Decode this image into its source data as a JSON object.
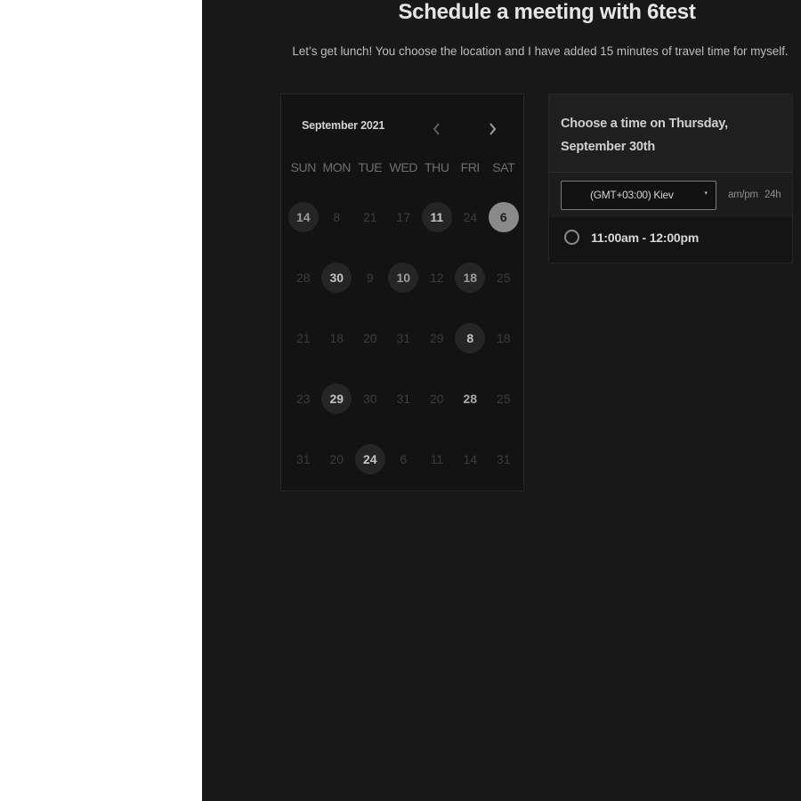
{
  "header": {
    "title": "Schedule a meeting with 6test",
    "subtitle": "Let’s get lunch! You choose the location and I have added 15 minutes of travel time for myself."
  },
  "calendar": {
    "month_label": "September 2021",
    "prev_icon": "chevron-left-icon",
    "next_icon": "chevron-right-icon",
    "weekdays": [
      "SUN",
      "MON",
      "TUE",
      "WED",
      "THU",
      "FRI",
      "SAT"
    ],
    "weeks": [
      [
        {
          "label": "14",
          "state": "available"
        },
        {
          "label": "8",
          "state": "disabled"
        },
        {
          "label": "21",
          "state": "disabled"
        },
        {
          "label": "17",
          "state": "disabled"
        },
        {
          "label": "11",
          "state": "available-light"
        },
        {
          "label": "24",
          "state": "disabled"
        },
        {
          "label": "6",
          "state": "selected"
        }
      ],
      [
        {
          "label": "28",
          "state": "disabled"
        },
        {
          "label": "30",
          "state": "available-light"
        },
        {
          "label": "9",
          "state": "disabled"
        },
        {
          "label": "10",
          "state": "available"
        },
        {
          "label": "12",
          "state": "disabled"
        },
        {
          "label": "18",
          "state": "available"
        },
        {
          "label": "25",
          "state": "disabled"
        }
      ],
      [
        {
          "label": "21",
          "state": "disabled"
        },
        {
          "label": "18",
          "state": "disabled"
        },
        {
          "label": "20",
          "state": "disabled"
        },
        {
          "label": "31",
          "state": "disabled"
        },
        {
          "label": "29",
          "state": "disabled"
        },
        {
          "label": "8",
          "state": "available-light"
        },
        {
          "label": "18",
          "state": "disabled"
        }
      ],
      [
        {
          "label": "23",
          "state": "disabled"
        },
        {
          "label": "29",
          "state": "available-light"
        },
        {
          "label": "30",
          "state": "disabled"
        },
        {
          "label": "31",
          "state": "disabled"
        },
        {
          "label": "20",
          "state": "disabled"
        },
        {
          "label": "28",
          "state": "bold-only"
        },
        {
          "label": "25",
          "state": "disabled"
        }
      ],
      [
        {
          "label": "31",
          "state": "disabled"
        },
        {
          "label": "20",
          "state": "disabled"
        },
        {
          "label": "24",
          "state": "available-light"
        },
        {
          "label": "6",
          "state": "disabled"
        },
        {
          "label": "11",
          "state": "disabled"
        },
        {
          "label": "14",
          "state": "disabled"
        },
        {
          "label": "31",
          "state": "disabled"
        }
      ]
    ]
  },
  "time_panel": {
    "heading": "Choose a time on Thursday, September 30th",
    "timezone_value": "(GMT+03:00) Kiev",
    "timezone_caret": "▾",
    "format_ampm": "am/pm",
    "format_24h": "24h",
    "slots": [
      {
        "label": "11:00am - 12:00pm"
      }
    ]
  },
  "colors": {
    "panel_bg": "#181818",
    "card_bg": "#131313",
    "selected_day": "#8a8a8a"
  }
}
